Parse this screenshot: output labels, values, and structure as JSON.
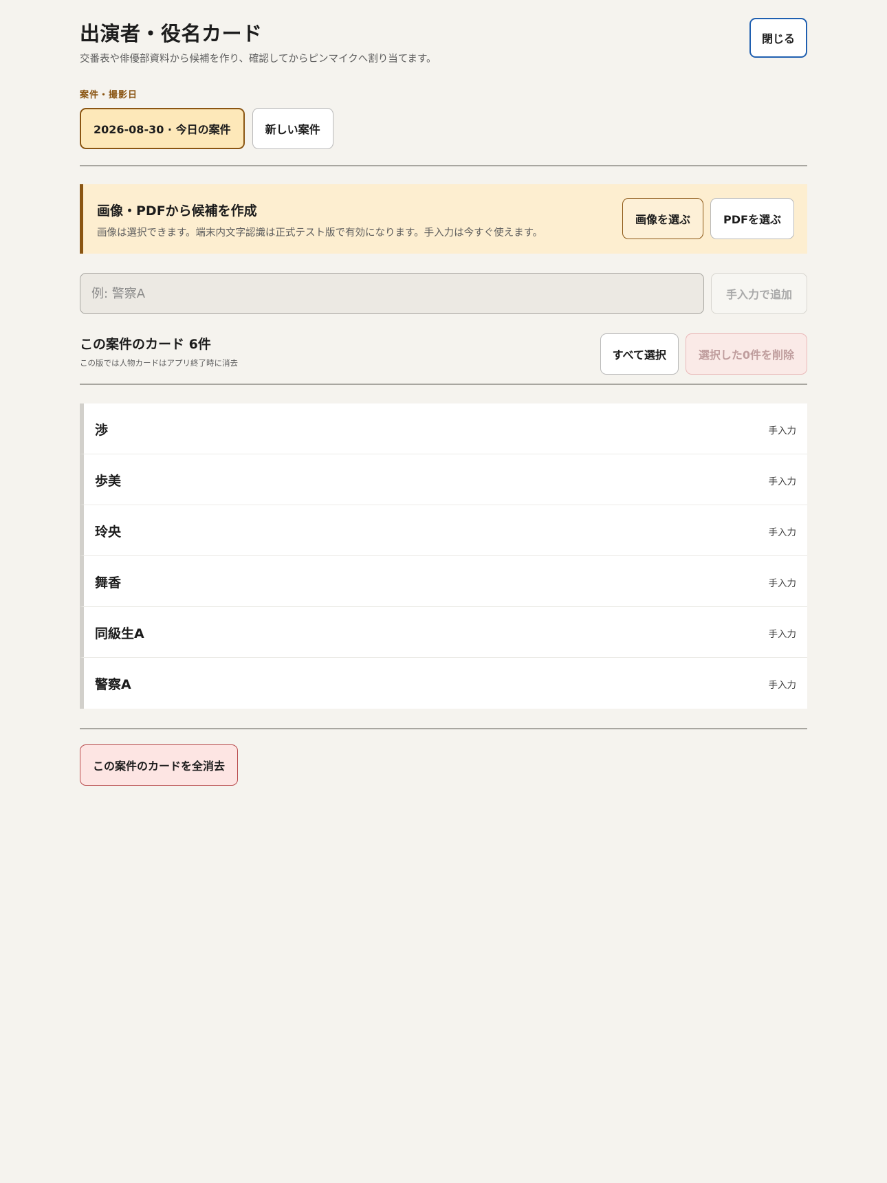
{
  "header": {
    "title": "出演者・役名カード",
    "subtitle": "交番表や俳優部資料から候補を作り、確認してからピンマイクへ割り当てます。",
    "close_label": "閉じる"
  },
  "case_section": {
    "label": "案件・撮影日",
    "current_case": "2026-08-30 · 今日の案件",
    "new_case": "新しい案件"
  },
  "import": {
    "title": "画像・PDFから候補を作成",
    "description": "画像は選択できます。端末内文字認識は正式テスト版で有効になります。手入力は今すぐ使えます。",
    "pick_image_label": "画像を選ぶ",
    "pick_pdf_label": "PDFを選ぶ"
  },
  "manual": {
    "placeholder": "例: 警察A",
    "value": "",
    "add_label": "手入力で追加"
  },
  "cards": {
    "heading": "この案件のカード 6件",
    "note": "この版では人物カードはアプリ終了時に消去",
    "select_all_label": "すべて選択",
    "delete_selected_label": "選択した0件を削除",
    "items": [
      {
        "name": "渉",
        "source": "手入力"
      },
      {
        "name": "歩美",
        "source": "手入力"
      },
      {
        "name": "玲央",
        "source": "手入力"
      },
      {
        "name": "舞香",
        "source": "手入力"
      },
      {
        "name": "同級生A",
        "source": "手入力"
      },
      {
        "name": "警察A",
        "source": "手入力"
      }
    ]
  },
  "footer": {
    "clear_all_label": "この案件のカードを全消去"
  },
  "colors": {
    "background": "#f5f3ee",
    "accent_brown": "#8a5512",
    "accent_blue": "#1f5fb0",
    "import_panel": "#fdeed0",
    "danger": "#b8494b"
  }
}
